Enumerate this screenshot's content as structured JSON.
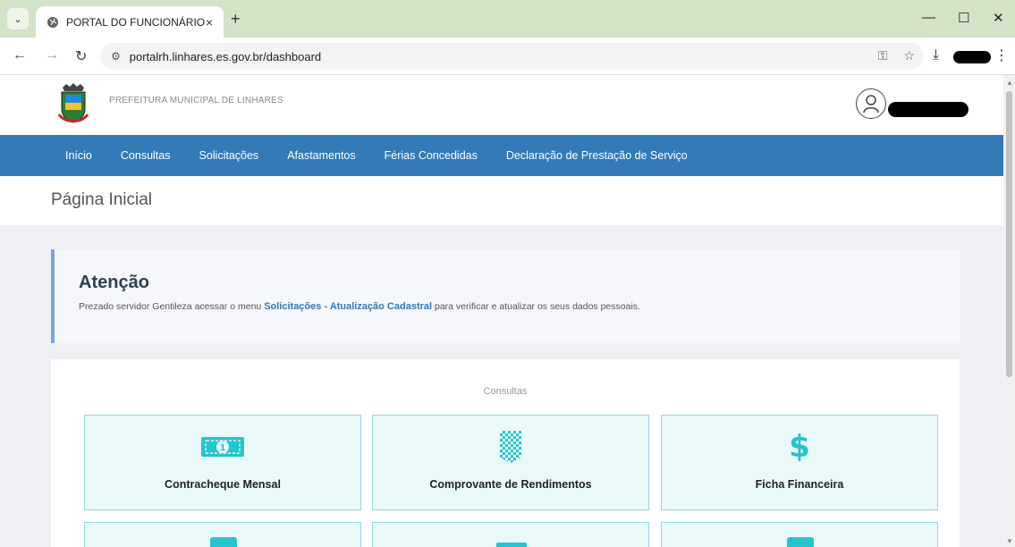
{
  "browser": {
    "tab_title": "PORTAL DO FUNCIONÁRIO",
    "tab_close": "×",
    "new_tab": "+",
    "url": "portalrh.linhares.es.gov.br/dashboard",
    "window_controls": {
      "minimize": "—",
      "maximize": "☐",
      "close": "✕"
    }
  },
  "header": {
    "org_name": "PREFEITURA MUNICIPAL DE LINHARES"
  },
  "nav": {
    "items": [
      {
        "label": "Início"
      },
      {
        "label": "Consultas"
      },
      {
        "label": "Solicitações"
      },
      {
        "label": "Afastamentos"
      },
      {
        "label": "Férias Concedidas"
      },
      {
        "label": "Declaração de Prestação de Serviço"
      }
    ]
  },
  "page": {
    "title": "Página Inicial"
  },
  "alert": {
    "title": "Atenção",
    "text_before": "Prezado servidor Gentileza acessar o menu ",
    "link": "Solicitações - Atualização Cadastral",
    "text_after": " para verificar e atualizar os seus dados pessoais."
  },
  "consultas": {
    "title": "Consultas",
    "cards": [
      {
        "label": "Contracheque Mensal",
        "icon": "money-bill-icon"
      },
      {
        "label": "Comprovante de Rendimentos",
        "icon": "checkered-icon"
      },
      {
        "label": "Ficha Financeira",
        "icon": "dollar-icon",
        "symbol": "$"
      }
    ]
  },
  "colors": {
    "nav_blue": "#337ab7",
    "accent_teal": "#25c4cf",
    "card_bg": "#e9f8f9",
    "card_border": "#8fd8dc",
    "tabbar_green": "#d3e3c7"
  }
}
